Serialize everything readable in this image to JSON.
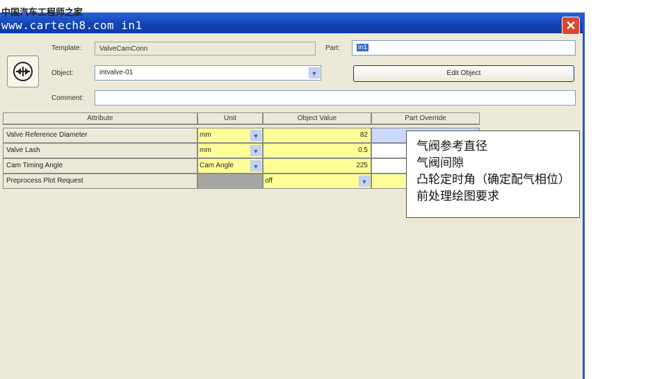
{
  "watermark": "中国汽车工程师之家",
  "window": {
    "title": "www.cartech8.com in1",
    "close_glyph": "✕"
  },
  "form": {
    "template_label": "Template:",
    "template_value": "ValveCamConn",
    "part_label": "Part:",
    "part_value": "in1",
    "object_label": "Object:",
    "object_value": "intvalve-01",
    "edit_button": "Edit Object",
    "comment_label": "Comment:",
    "comment_value": ""
  },
  "table": {
    "headers": [
      "Attribute",
      "Unit",
      "Object Value",
      "Part Override"
    ],
    "rows": [
      {
        "attribute": "Valve Reference Diameter",
        "unit": "mm",
        "value": "82",
        "override": ""
      },
      {
        "attribute": "Valve Lash",
        "unit": "mm",
        "value": "0.5",
        "override": ""
      },
      {
        "attribute": "Cam Timing Angle",
        "unit": "Cam Angle",
        "value": "225",
        "override": ""
      },
      {
        "attribute": "Preprocess Plot Request",
        "unit": "",
        "value": "off",
        "override": ""
      }
    ]
  },
  "annotation": {
    "lines": [
      "气阀参考直径",
      "气阀间隙",
      "凸轮定时角（确定配气相位）",
      "前处理绘图要求"
    ]
  },
  "icons": {
    "object_icon": "valve-connection-icon",
    "dropdown": "chevron-down-icon",
    "close": "close-icon"
  }
}
